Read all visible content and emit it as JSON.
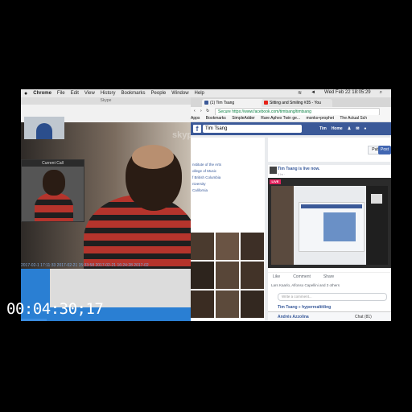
{
  "menubar": {
    "apple": "",
    "app": "Chrome",
    "items": [
      "File",
      "Edit",
      "View",
      "History",
      "Bookmarks",
      "People",
      "Window",
      "Help"
    ],
    "clock": "Wed Feb 22  18:05:29"
  },
  "skype": {
    "title": "Skype",
    "logo": "skype",
    "current_call": "Current Call",
    "timestamps": "2017-02-1 17:11:33  2017-02-21 15:33:58  2017-02-21 16:24:28  2017-02"
  },
  "chrome": {
    "tabs": [
      {
        "label": "(1) Tim Tsang",
        "fav_color": "#3b5998"
      },
      {
        "label": "Sitting and Smiling #35 - You",
        "fav_color": "#e62117"
      }
    ],
    "url": "Secure  https://www.facebook.com/timtsang/timtsang",
    "bookmarks": [
      "Apps",
      "Bookmarks",
      "SimpleAdder",
      "Rare Aphex Twin ge...",
      "monks+prophet",
      "The Actual Sch"
    ]
  },
  "facebook": {
    "logo": "f",
    "search": "Tim Tsang",
    "nav": [
      "Tim",
      "Home"
    ],
    "about": [
      "nstitute of the Arts",
      "ollege of Music",
      "f British Columbia",
      "niversity",
      "California"
    ],
    "public_label": "Public ▾",
    "post_label": "Post",
    "post": {
      "name": "Tim Tsang is live now.",
      "sub": "1 hr · ",
      "live_badge": "LIVE",
      "actions": [
        "Like",
        "Comment",
        "Share"
      ],
      "reactions": "Lars Kaarlo, Alfonso Capellini and 3 others",
      "comment_placeholder": "Write a comment...",
      "comment_author": "Tim Tsang » hyperrealtitling",
      "chat_user": "Andrés Azzolina",
      "chat_label": "Chat (81)"
    }
  },
  "timecode": "00:04:30;17",
  "colors": {
    "fb_blue": "#3b5998",
    "live_red": "#e0245e",
    "skype_blue": "#2a7fd3"
  }
}
